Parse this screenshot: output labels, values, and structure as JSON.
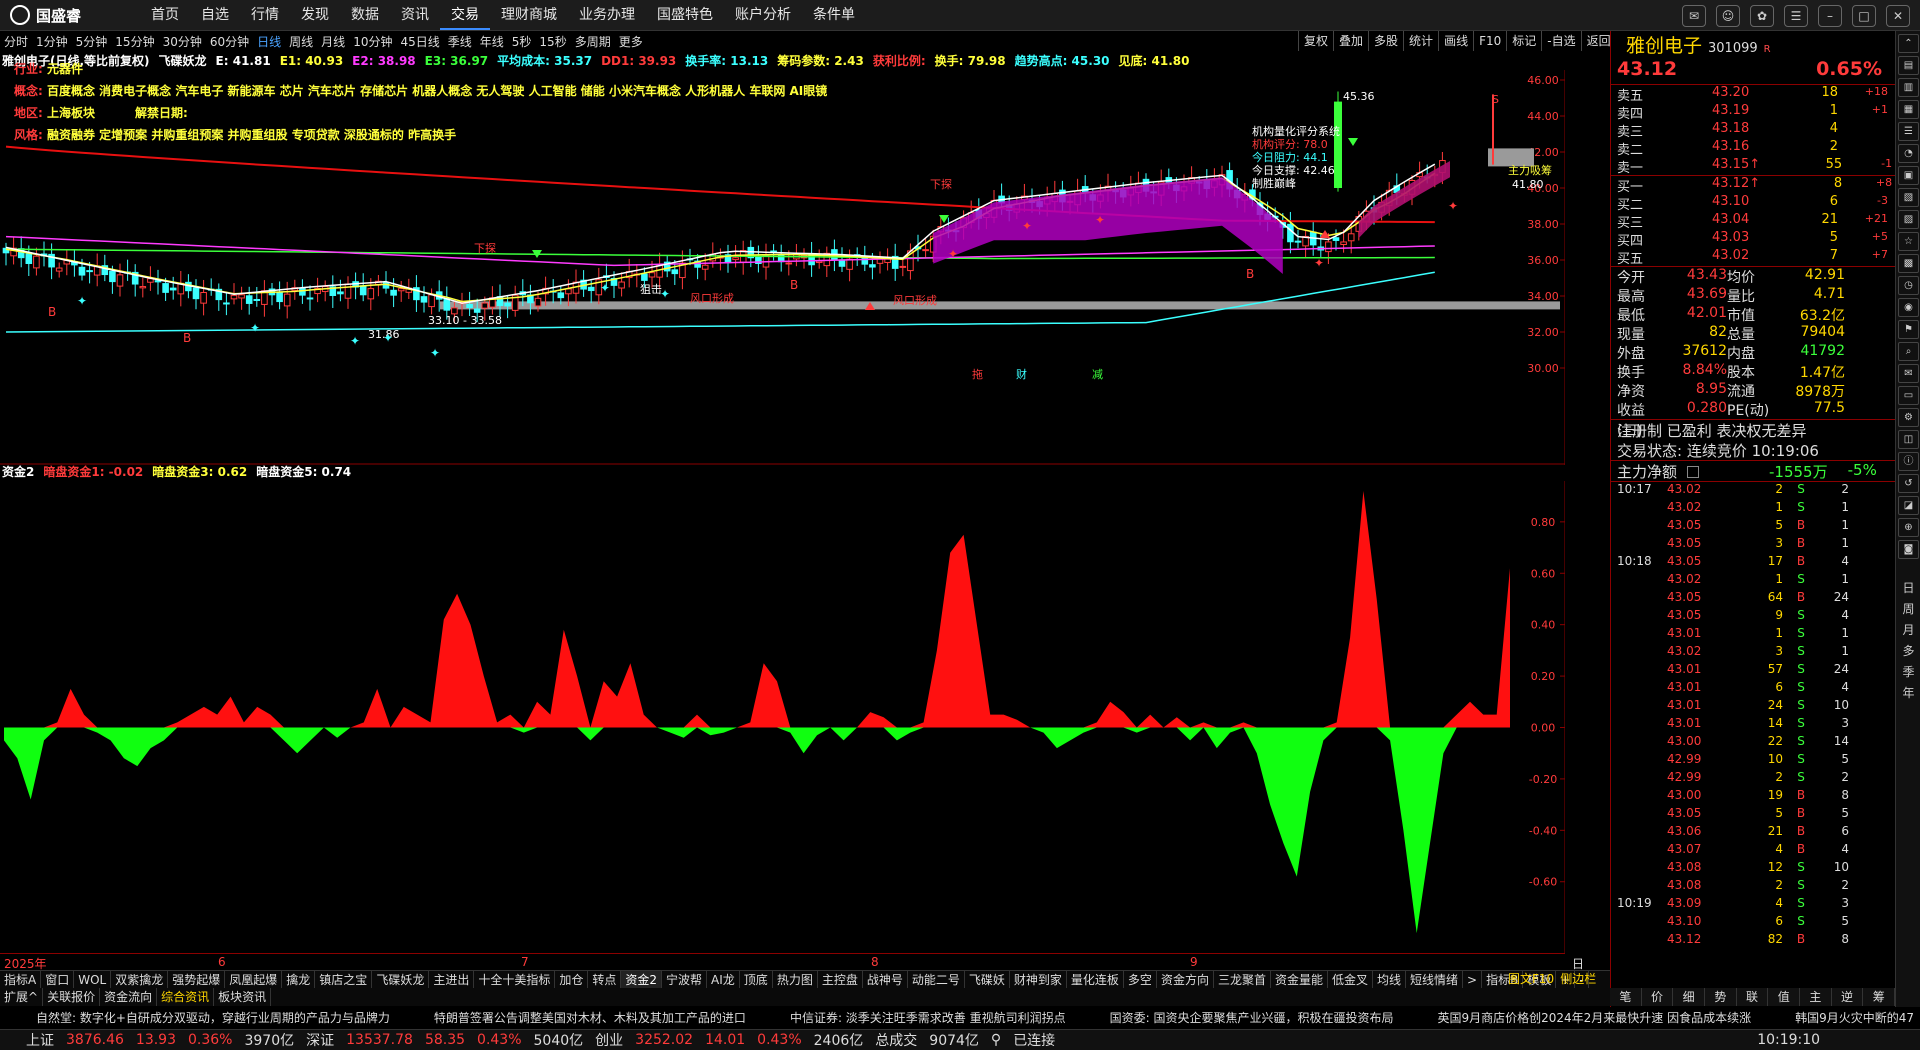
{
  "app": {
    "name": "国盛睿",
    "menu": [
      "首页",
      "自选",
      "行情",
      "发现",
      "数据",
      "资讯",
      "交易",
      "理财商城",
      "业务办理",
      "国盛特色",
      "账户分析",
      "条件单"
    ],
    "active_menu": "交易"
  },
  "periods": [
    "分时",
    "1分钟",
    "5分钟",
    "15分钟",
    "30分钟",
    "60分钟",
    "日线",
    "周线",
    "月线",
    "10分钟",
    "45日线",
    "季线",
    "年线",
    "5秒",
    "15秒",
    "多周期",
    "更多"
  ],
  "selected_period": "日线",
  "tools": [
    "复权",
    "叠加",
    "多股",
    "统计",
    "画线",
    "F10",
    "标记",
    "-自选",
    "返回"
  ],
  "indicator_line": [
    {
      "t": "雅创电子(日线,等比前复权)",
      "c": "#ffffff"
    },
    {
      "t": "飞碟妖龙",
      "c": "#ffffff"
    },
    {
      "t": "E: 41.81",
      "c": "#ffffff"
    },
    {
      "t": "E1: 40.93",
      "c": "#ffff3b"
    },
    {
      "t": "E2: 38.98",
      "c": "#ff3bff"
    },
    {
      "t": "E3: 36.97",
      "c": "#3bff3b"
    },
    {
      "t": "平均成本: 35.37",
      "c": "#3bffff"
    },
    {
      "t": "DD1: 39.93",
      "c": "#ff3b3b"
    },
    {
      "t": "换手率: 13.13",
      "c": "#3bffff"
    },
    {
      "t": "筹码参数: 2.43",
      "c": "#ffff3b"
    },
    {
      "t": "获利比例:",
      "c": "#ff3b3b"
    },
    {
      "t": "换手: 79.98",
      "c": "#ffff3b"
    },
    {
      "t": "趋势高点: 45.30",
      "c": "#3bffff"
    },
    {
      "t": "见底: 41.80",
      "c": "#ffff3b"
    }
  ],
  "info": {
    "industry_k": "行业:",
    "industry_v": "元器件",
    "concept_k": "概念:",
    "concept_v": "百度概念 消费电子概念 汽车电子 新能源车 芯片 汽车芯片 存储芯片 机器人概念 无人驾驶 人工智能 储能 小米汽车概念 人形机器人 车联网 AI眼镜",
    "region_k": "地区:",
    "region_v": "上海板块",
    "unlock_k": "解禁日期:",
    "style_k": "风格:",
    "style_v": "融资融券 定增预案 并购重组预案 并购重组股 专项贷款 深股通标的 昨高换手"
  },
  "overlay": {
    "title": "机构量化评分系统",
    "score": "机构评分: 78.0",
    "resistance": "今日阻力: 44.1",
    "support": "今日支撑: 42.46",
    "label": "制胜巅峰"
  },
  "annotations": {
    "high": "45.36",
    "low_range": "33.10 - 33.58",
    "low2": "31.86",
    "last": "41.80",
    "tuo": "拖",
    "xiatan1": "下探",
    "xiatan2": "下探",
    "zuji": "狙击",
    "fk1": "风口形成",
    "fk2": "风口形成",
    "b": "B",
    "cai": "财",
    "jian": "减",
    "zhuli": "主力吸筹",
    "s": "S"
  },
  "price_axis": [
    "46.00",
    "44.00",
    "42.00",
    "40.00",
    "38.00",
    "36.00",
    "34.00",
    "32.00",
    "30.00"
  ],
  "sub_axis": [
    "0.80",
    "0.60",
    "0.40",
    "0.20",
    "0.00",
    "-0.20",
    "-0.40",
    "-0.60"
  ],
  "sub_line": [
    {
      "t": "资金2",
      "c": "#ffffff"
    },
    {
      "t": "暗盘资金1: -0.02",
      "c": "#ff3b3b"
    },
    {
      "t": "暗盘资金3: 0.62",
      "c": "#ffff3b"
    },
    {
      "t": "暗盘资金5: 0.74",
      "c": "#ffffff"
    }
  ],
  "time_axis": {
    "year": "2025年",
    "m6": "6",
    "m7": "7",
    "m8": "8",
    "m9": "9",
    "period": "日线"
  },
  "chart_data": {
    "type": "area",
    "title": "资金2",
    "ylim": [
      -0.85,
      0.92
    ],
    "values": [
      -0.05,
      -0.12,
      -0.28,
      -0.05,
      0.02,
      0.15,
      0.05,
      -0.02,
      -0.05,
      -0.12,
      -0.15,
      -0.08,
      -0.05,
      0.02,
      0.05,
      0.08,
      0.05,
      0.12,
      0.02,
      0.08,
      0.05,
      -0.05,
      -0.1,
      -0.05,
      0.0,
      -0.04,
      0.0,
      0.02,
      0.15,
      0.0,
      0.08,
      0.05,
      0.02,
      0.42,
      0.52,
      0.4,
      0.2,
      0.02,
      0.05,
      -0.02,
      0.1,
      0.05,
      0.38,
      0.2,
      -0.05,
      0.18,
      0.12,
      0.25,
      0.05,
      0.0,
      -0.02,
      -0.04,
      0.05,
      -0.03,
      -0.02,
      0.0,
      0.02,
      0.25,
      0.18,
      -0.02,
      -0.1,
      -0.03,
      0.0,
      -0.05,
      0.0,
      0.06,
      0.04,
      -0.05,
      -0.02,
      0.02,
      0.3,
      0.68,
      0.75,
      0.4,
      0.05,
      0.05,
      0.03,
      0.0,
      -0.02,
      -0.08,
      -0.05,
      -0.02,
      0.02,
      0.1,
      0.06,
      -0.02,
      0.05,
      0.0,
      0.04,
      -0.05,
      0.02,
      -0.08,
      -0.02,
      0.02,
      -0.1,
      -0.3,
      -0.45,
      -0.58,
      -0.25,
      -0.05,
      0.02,
      0.35,
      0.92,
      0.5,
      -0.05,
      -0.4,
      -0.8,
      -0.45,
      -0.1,
      0.05,
      0.1,
      0.05,
      0.05,
      0.62
    ],
    "x_labels": [
      "2025年",
      "6",
      "7",
      "8",
      "9"
    ]
  },
  "quote": {
    "name": "雅创电子",
    "code": "301099",
    "suffix": "R",
    "price": "43.12",
    "pct": "0.65%",
    "asks": [
      [
        "卖五",
        "43.20",
        "18",
        "+18"
      ],
      [
        "卖四",
        "43.19",
        "1",
        "+1"
      ],
      [
        "卖三",
        "43.18",
        "4",
        ""
      ],
      [
        "卖二",
        "43.16",
        "2",
        ""
      ],
      [
        "卖一",
        "43.15↑",
        "55",
        "-1"
      ]
    ],
    "bids": [
      [
        "买一",
        "43.12↑",
        "8",
        "+8"
      ],
      [
        "买二",
        "43.10",
        "6",
        "-3"
      ],
      [
        "买三",
        "43.04",
        "21",
        "+21"
      ],
      [
        "买四",
        "43.03",
        "5",
        "+5"
      ],
      [
        "买五",
        "43.02",
        "7",
        "+7"
      ]
    ],
    "stats": [
      [
        "今开",
        "43.43",
        "均价",
        "42.91"
      ],
      [
        "最高",
        "43.69",
        "量比",
        "4.71"
      ],
      [
        "最低",
        "42.01",
        "市值",
        "63.2亿"
      ],
      [
        "现量",
        "82",
        "总量",
        "79404"
      ],
      [
        "外盘",
        "37612",
        "内盘",
        "41792"
      ],
      [
        "换手",
        "8.84%",
        "股本",
        "1.47亿"
      ],
      [
        "净资",
        "8.95",
        "流通",
        "8978万"
      ],
      [
        "收益(三)",
        "0.280",
        "PE(动)",
        "77.5"
      ]
    ],
    "reg": "注册制 已盈利 表决权无差异",
    "trade_state": "交易状态: 连续竞价 10:19:06",
    "flow_label": "主力净额",
    "flow_value": "-1555万",
    "flow_pct": "-5%",
    "ticks": [
      [
        "10:17",
        "43.02",
        "2",
        "S",
        "2"
      ],
      [
        "",
        "43.02",
        "1",
        "S",
        "1"
      ],
      [
        "",
        "43.05",
        "5",
        "B",
        "1"
      ],
      [
        "",
        "43.05",
        "3",
        "B",
        "1"
      ],
      [
        "10:18",
        "43.05",
        "17",
        "B",
        "4"
      ],
      [
        "",
        "43.02",
        "1",
        "S",
        "1"
      ],
      [
        "",
        "43.05",
        "64",
        "B",
        "24"
      ],
      [
        "",
        "43.05",
        "9",
        "S",
        "4"
      ],
      [
        "",
        "43.01",
        "1",
        "S",
        "1"
      ],
      [
        "",
        "43.02",
        "3",
        "S",
        "1"
      ],
      [
        "",
        "43.01",
        "57",
        "S",
        "24"
      ],
      [
        "",
        "43.01",
        "6",
        "S",
        "4"
      ],
      [
        "",
        "43.01",
        "24",
        "S",
        "10"
      ],
      [
        "",
        "43.01",
        "14",
        "S",
        "3"
      ],
      [
        "",
        "43.00",
        "22",
        "S",
        "14"
      ],
      [
        "",
        "42.99",
        "10",
        "S",
        "5"
      ],
      [
        "",
        "42.99",
        "2",
        "S",
        "2"
      ],
      [
        "",
        "43.00",
        "19",
        "B",
        "8"
      ],
      [
        "",
        "43.05",
        "5",
        "B",
        "5"
      ],
      [
        "",
        "43.06",
        "21",
        "B",
        "6"
      ],
      [
        "",
        "43.07",
        "4",
        "B",
        "4"
      ],
      [
        "",
        "43.08",
        "12",
        "S",
        "10"
      ],
      [
        "",
        "43.08",
        "2",
        "S",
        "2"
      ],
      [
        "10:19",
        "43.09",
        "4",
        "S",
        "3"
      ],
      [
        "",
        "43.10",
        "6",
        "S",
        "5"
      ],
      [
        "",
        "43.12",
        "82",
        "B",
        "8"
      ]
    ],
    "tabs": [
      "笔",
      "价",
      "细",
      "势",
      "联",
      "值",
      "主",
      "逆",
      "筹"
    ]
  },
  "sub_tabs": [
    "指标A",
    "窗口",
    "WOL",
    "双紫擒龙",
    "强势起爆",
    "凤凰起爆",
    "擒龙",
    "镇店之宝",
    "飞碟妖龙",
    "主进出",
    "十全十美指标",
    "加仓",
    "转点",
    "资金2",
    "宁波帮",
    "AI龙",
    "顶底",
    "热力图",
    "主控盘",
    "战神号",
    "动能二号",
    "飞碟妖",
    "财神到家",
    "量化连板",
    "多空",
    "资金方向",
    "三龙聚首",
    "资金量能",
    "低金叉",
    "均线",
    "短线情绪",
    ">",
    "指标B",
    "模板",
    "+",
    "-"
  ],
  "sub_tabs2": [
    "扩展^",
    "关联报价",
    "资金流向",
    "综合资讯",
    "板块资讯"
  ],
  "right_tabs_top": [
    "图文F10",
    "侧边栏"
  ],
  "news": [
    "自然堂: 数字化+自研成分双驱动，穿越行业周期的产品力与品牌力",
    "特朗普签署公告调整美国对木材、木料及其加工产品的进口",
    "中信证券: 淡季关注旺季需求改善 重视航司利润拐点",
    "国资委: 国资央企要聚焦产业兴疆，积极在疆投资布局",
    "英国9月商店价格创2024年2月来最快升速 因食品成本续涨",
    "韩国9月火灾中断的47"
  ],
  "status": {
    "sh": "上证",
    "sh_v": "3876.46",
    "sh_c": "13.93",
    "sh_p": "0.36%",
    "sh_a": "3970亿",
    "sz": "深证",
    "sz_v": "13537.78",
    "sz_c": "58.35",
    "sz_p": "0.43%",
    "sz_a": "5040亿",
    "cy": "创业",
    "cy_v": "3252.02",
    "cy_c": "14.01",
    "cy_p": "0.43%",
    "cy_a": "2406亿",
    "total": "总成交",
    "total_v": "9074亿",
    "conn": "已连接",
    "time": "10:19:10"
  },
  "sidebar": [
    "日",
    "周",
    "月",
    "多",
    "季",
    "年"
  ],
  "colors": {
    "up": "#ff3b3b",
    "down": "#3bff3b",
    "ma_white": "#ffffff",
    "ma_yellow": "#ffff3b",
    "ma_magenta": "#ff3bff",
    "ma_green": "#3bff3b",
    "ma_cyan": "#3bffff",
    "ma_red": "#e81010",
    "fill_magenta": "#b000c0"
  }
}
